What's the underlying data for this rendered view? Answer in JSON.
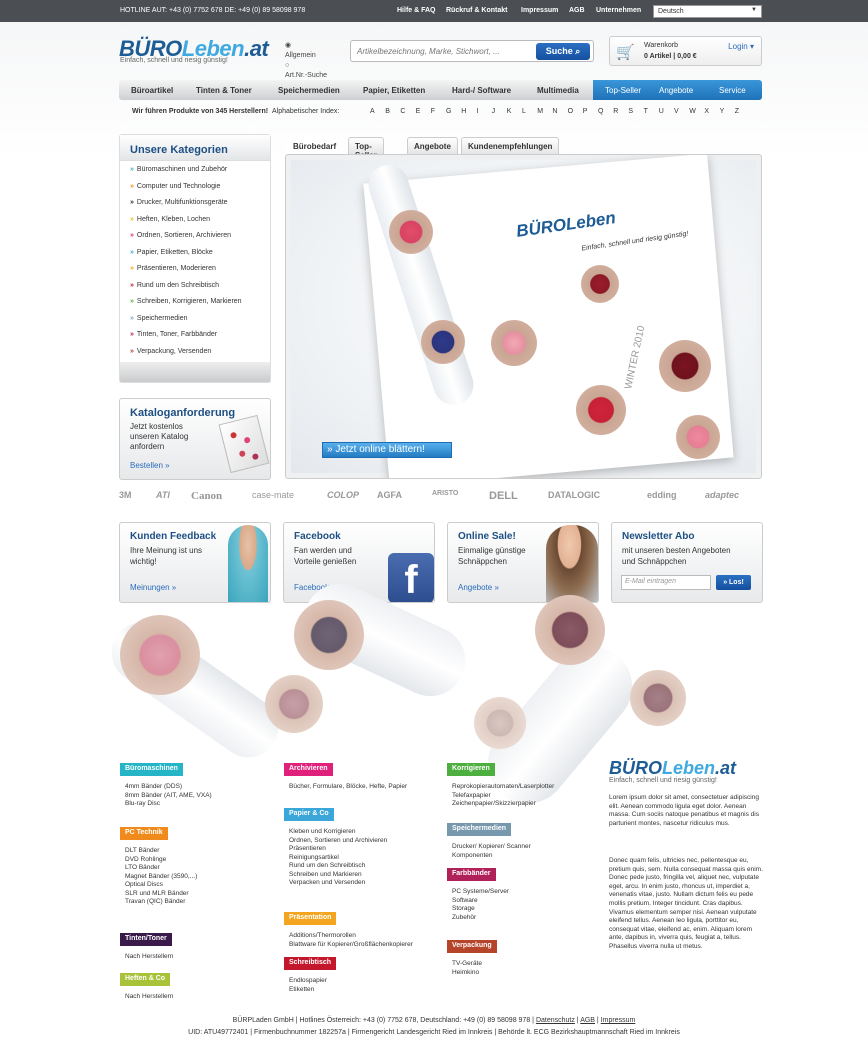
{
  "topbar": {
    "hotline": "HOTLINE AUT: +43 (0) 7752 678   DE: +49 (0) 89 58098 978",
    "links": [
      "Hilfe & FAQ",
      "Rückruf & Kontakt",
      "Impressum",
      "AGB",
      "Unternehmen"
    ],
    "language": "Deutsch"
  },
  "header": {
    "logo_part1": "BÜRO",
    "logo_part2": "Leben",
    "logo_part3": ".at",
    "slogan": "Einfach, schnell und riesig günstig!",
    "radio_all": "Allgemein",
    "radio_art": "Art.Nr.-Suche",
    "search_placeholder": "Artikelbezeichnung, Marke, Stichwort, ...",
    "search_button": "Suche",
    "cart_label": "Warenkorb",
    "cart_summary": "0 Artikel | 0,00 €",
    "login": "Login"
  },
  "nav": {
    "items": [
      "Büroartikel",
      "Tinten & Toner",
      "Speichermedien",
      "Papier, Etiketten",
      "Hard-/ Software",
      "Multimedia"
    ],
    "highlight": [
      "Top-Seller",
      "Angebote",
      "Service"
    ]
  },
  "index": {
    "intro": "Wir führen Produkte von 345 Herstellern!",
    "label": "Alphabetischer Index:",
    "letters": [
      "A",
      "B",
      "C",
      "E",
      "F",
      "G",
      "H",
      "I",
      "J",
      "K",
      "L",
      "M",
      "N",
      "O",
      "P",
      "Q",
      "R",
      "S",
      "T",
      "U",
      "V",
      "W",
      "X",
      "Y",
      "Z"
    ]
  },
  "sidebar": {
    "title": "Unsere Kategorien",
    "items": [
      {
        "label": "Büromaschinen und Zubehör",
        "color": "#3fb0c9"
      },
      {
        "label": "Computer und Technologie",
        "color": "#f08a1c"
      },
      {
        "label": "Drucker, Multifunktionsgeräte",
        "color": "#333333"
      },
      {
        "label": "Heften, Kleben, Lochen",
        "color": "#e8c21a"
      },
      {
        "label": "Ordnen, Sortieren, Archivieren",
        "color": "#e02a7b"
      },
      {
        "label": "Papier, Etiketten, Blöcke",
        "color": "#3fa9e0"
      },
      {
        "label": "Präsentieren, Moderieren",
        "color": "#f5a623"
      },
      {
        "label": "Rund um den Schreibtisch",
        "color": "#c4172c"
      },
      {
        "label": "Schreiben, Korrigieren, Markieren",
        "color": "#58b248"
      },
      {
        "label": "Speichermedien",
        "color": "#7fa7c4"
      },
      {
        "label": "Tinten, Toner, Farbbänder",
        "color": "#b0215a"
      },
      {
        "label": "Verpackung, Versenden",
        "color": "#b5442a"
      }
    ]
  },
  "catalog": {
    "title": "Kataloganforderung",
    "text": "Jetzt kostenlos unseren Katalog anfordern",
    "link": "Bestellen »"
  },
  "tabs": [
    "Bürobedarf",
    "Top-Seller",
    "Angebote",
    "Kundenempfehlungen"
  ],
  "hero": {
    "brand": "BÜROLeben",
    "slogan": "Einfach, schnell und riesig günstig!",
    "season": "WINTER 2010",
    "button": "» Jetzt online blättern!"
  },
  "brands": [
    "3M",
    "ATI",
    "Canon",
    "case-mate",
    "COLOP",
    "AGFA",
    "ARISTO",
    "DELL",
    "DATALOGIC",
    "edding",
    "adaptec"
  ],
  "boxes": [
    {
      "title": "Kunden Feedback",
      "text1": "Ihre Meinung ist uns",
      "text2": "wichtig!",
      "link": "Meinungen »"
    },
    {
      "title": "Facebook",
      "text1": "Fan werden und",
      "text2": "Vorteile genießen",
      "link": "Facebook »"
    },
    {
      "title": "Online Sale!",
      "text1": "Einmalige günstige",
      "text2": "Schnäppchen",
      "link": "Angebote »"
    },
    {
      "title": "Newsletter Abo",
      "text1": "mit unseren besten Angeboten",
      "text2": "und Schnäppchen",
      "placeholder": "E-Mail eintragen",
      "button": "» Los!"
    }
  ],
  "footer": {
    "col1": [
      {
        "title": "Büromaschinen",
        "color": "#25b5c7",
        "items": [
          "4mm Bänder (DDS)",
          "8mm Bänder (AIT, AME, VXA)",
          "Blu-ray Disc"
        ]
      },
      {
        "title": "PC Technik",
        "color": "#f08a1c",
        "items": [
          "DLT Bänder",
          "DVD Rohlinge",
          "LTO Bänder",
          "Magnet Bänder (3590,...)",
          "Optical Discs",
          "SLR und MLR Bänder",
          "Travan (QIC) Bänder"
        ]
      },
      {
        "title": "Tinten/Toner",
        "color": "#3a1a4a",
        "items": [
          "Nach Herstellern"
        ]
      },
      {
        "title": "Heften & Co",
        "color": "#a8c23a",
        "items": [
          "Nach Herstellern"
        ]
      }
    ],
    "col2": [
      {
        "title": "Archivieren",
        "color": "#e0217b",
        "items": [
          "Bücher, Formulare, Blöcke, Hefte, Papier"
        ]
      },
      {
        "title": "Papier & Co",
        "color": "#3aa6d9",
        "items": [
          "Kleben und Korrigieren",
          "Ordnen, Sortieren und Archivieren",
          "Präsentieren",
          "Reinigungsartikel",
          "Rund um den Schreibtisch",
          "Schreiben und Markieren",
          "Verpacken und Versenden"
        ]
      },
      {
        "title": "Präsentation",
        "color": "#f4a51f",
        "items": [
          "Additions/Thermorollen",
          "Blattware für Kopierer/Großflächenkopierer"
        ]
      },
      {
        "title": "Schreibtisch",
        "color": "#c4172c",
        "items": [
          "Endlospapier",
          "Etiketten"
        ]
      }
    ],
    "col3": [
      {
        "title": "Korrigieren",
        "color": "#4caf3f",
        "items": [
          "Reprokopierautomaten/Laserplotter",
          "Telefaxpapier",
          "Zeichenpapier/Skizzierpapier"
        ]
      },
      {
        "title": "Speichermedien",
        "color": "#7898ad",
        "items": [
          "Drucker/ Kopierer/ Scanner",
          "Komponenten"
        ]
      },
      {
        "title": "Farbbänder",
        "color": "#b0215a",
        "items": [
          "PC Systeme/Server",
          "Software",
          "Storage",
          "Zubehör"
        ]
      },
      {
        "title": "Verpackung",
        "color": "#b5442a",
        "items": [
          "TV-Geräte",
          "Heimkino"
        ]
      }
    ],
    "logo_part1": "BÜRO",
    "logo_part2": "Leben",
    "logo_part3": ".at",
    "slogan": "Einfach, schnell und riesig günstig!",
    "para1": "Lorem ipsum dolor sit amet, consectetuer adipiscing elit. Aenean commodo ligula eget dolor. Aenean massa. Cum sociis natoque penatibus et magnis dis parturient montes, nascetur ridiculus mus.",
    "para2": "Donec quam felis, ultricies nec, pellentesque eu, pretium quis, sem. Nulla consequat massa quis enim. Donec pede justo, fringilla vel, aliquet nec, vulputate eget, arcu. In enim justo, rhoncus ut, imperdiet a, venenatis vitae, justo. Nullam dictum felis eu pede mollis pretium. Integer tincidunt. Cras dapibus. Vivamus elementum semper nisi. Aenean vulputate eleifend tellus. Aenean leo ligula, porttitor eu, consequat vitae, eleifend ac, enim. Aliquam lorem ante, dapibus in, viverra quis, feugiat a, tellus. Phasellus viverra nulla ut metus.",
    "imprint1": "BÜRPLaden GmbH  |  Hotlines Österreich: +43 (0) 7752 678, Deutschland: +49 (0) 89 58098 978  |",
    "imprint_links": [
      "Datenschutz",
      "AGB",
      "Impressum"
    ],
    "imprint2": "UID: ATU49772401  |  Firmenbuchnummer 182257a  |  Firmengericht Landesgericht Ried im Innkreis  |  Behörde lt. ECG Bezirkshauptmannschaft Ried im Innkreis"
  }
}
